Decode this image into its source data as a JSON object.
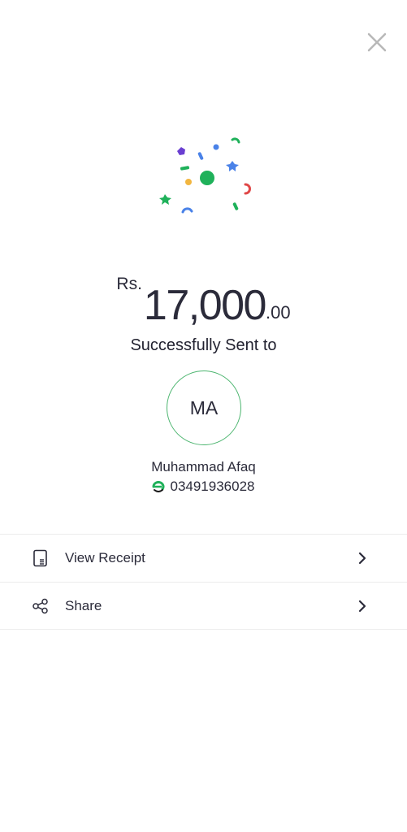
{
  "header": {
    "close_icon": "close-icon"
  },
  "colors": {
    "accent": "#4cb56f",
    "text": "#2b2b3a",
    "divider": "#ececec"
  },
  "transaction": {
    "currency": "Rs.",
    "amount_main": "17,000",
    "amount_decimal": ".00",
    "status": "Successfully Sent to"
  },
  "recipient": {
    "initials": "MA",
    "name": "Muhammad Afaq",
    "phone": "03491936028",
    "provider_icon": "easypaisa-logo-icon"
  },
  "actions": [
    {
      "label": "View Receipt",
      "icon": "receipt-icon"
    },
    {
      "label": "Share",
      "icon": "share-icon"
    }
  ]
}
